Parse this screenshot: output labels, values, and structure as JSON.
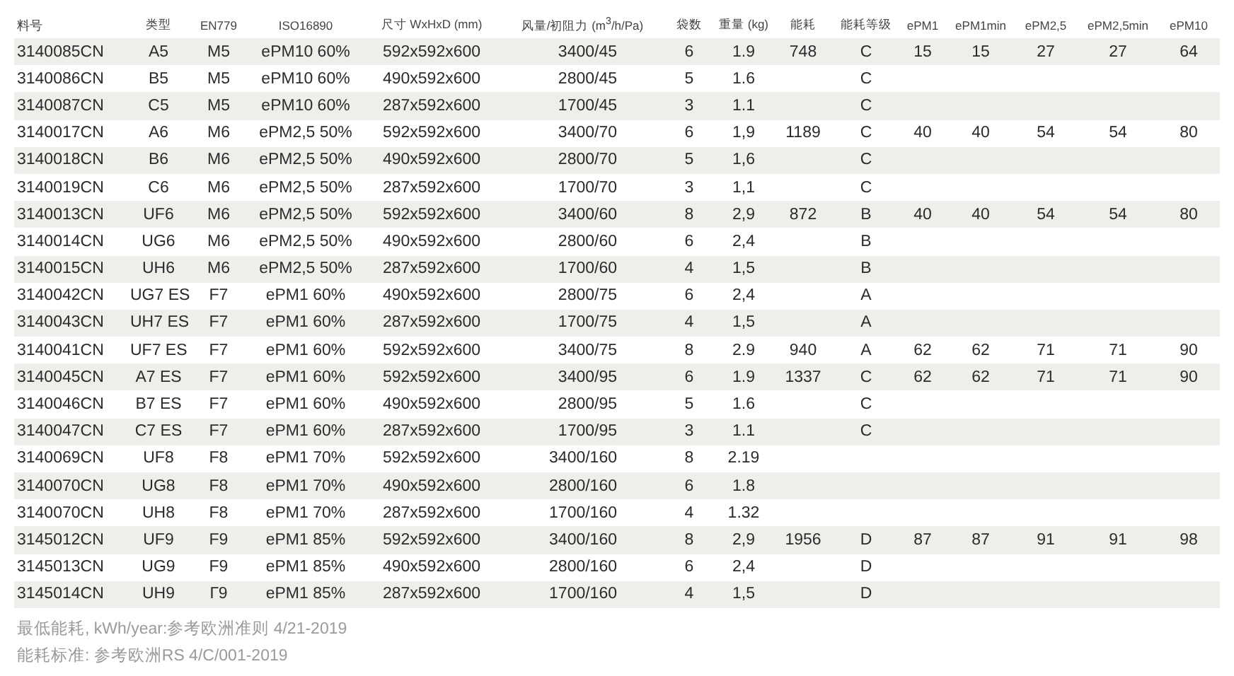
{
  "table": {
    "columns": [
      "料号",
      "类型",
      "EN779",
      "ISO16890",
      "尺寸 WxHxD (mm)",
      "风量/初阻力 (m$^{3}$/h/Pa)",
      "袋数",
      "重量 (kg)",
      "能耗",
      "能耗等级",
      "ePM1",
      "ePM1min",
      "ePM2,5",
      "ePM2,5min",
      "ePM10"
    ],
    "rows": [
      {
        "part_no": "3140085CN",
        "type": "A5",
        "en779": "M5",
        "iso16890": "ePM10 60%",
        "size": "592x592x600",
        "airflow": "3400/45",
        "bags": "6",
        "weight": "1.9",
        "energy": "748",
        "energy_class": "C",
        "epm1": "15",
        "epm1_min": "15",
        "epm2_5": "27",
        "epm2_5_min": "27",
        "epm10": "64"
      },
      {
        "part_no": "3140086CN",
        "type": "B5",
        "en779": "M5",
        "iso16890": "ePM10 60%",
        "size": "490x592x600",
        "airflow": "2800/45",
        "bags": "5",
        "weight": "1.6",
        "energy_class": "C"
      },
      {
        "part_no": "3140087CN",
        "type": "C5",
        "en779": "M5",
        "iso16890": "ePM10 60%",
        "size": "287x592x600",
        "airflow": "1700/45",
        "bags": "3",
        "weight": "1.1",
        "energy_class": "C"
      },
      {
        "part_no": "3140017CN",
        "type": "A6",
        "en779": "M6",
        "iso16890": "ePM2,5 50%",
        "size": "592x592x600",
        "airflow": "3400/70",
        "bags": "6",
        "weight": "1,9",
        "energy": "1189",
        "energy_class": "C",
        "epm1": "40",
        "epm1_min": "40",
        "epm2_5": "54",
        "epm2_5_min": "54",
        "epm10": "80"
      },
      {
        "part_no": "3140018CN",
        "type": "B6",
        "en779": "M6",
        "iso16890": "ePM2,5 50%",
        "size": "490x592x600",
        "airflow": "2800/70",
        "bags": "5",
        "weight": "1,6",
        "energy_class": "C"
      },
      {
        "part_no": "3140019CN",
        "type": "C6",
        "en779": "M6",
        "iso16890": "ePM2,5 50%",
        "size": "287x592x600",
        "airflow": "1700/70",
        "bags": "3",
        "weight": "1,1",
        "energy_class": "C"
      },
      {
        "part_no": "3140013CN",
        "type": "UF6",
        "en779": "M6",
        "iso16890": "ePM2,5 50%",
        "size": "592x592x600",
        "airflow": "3400/60",
        "bags": "8",
        "weight": "2,9",
        "energy": "872",
        "energy_class": "B",
        "epm1": "40",
        "epm1_min": "40",
        "epm2_5": "54",
        "epm2_5_min": "54",
        "epm10": "80"
      },
      {
        "part_no": "3140014CN",
        "type": "UG6",
        "en779": "M6",
        "iso16890": "ePM2,5 50%",
        "size": "490x592x600",
        "airflow": "2800/60",
        "bags": "6",
        "weight": "2,4",
        "energy_class": "B"
      },
      {
        "part_no": "3140015CN",
        "type": "UH6",
        "en779": "M6",
        "iso16890": "ePM2,5 50%",
        "size": "287x592x600",
        "airflow": "1700/60",
        "bags": "4",
        "weight": "1,5",
        "energy_class": "B"
      },
      {
        "part_no": "3140042CN",
        "type": "UG7 ES",
        "en779": "F7",
        "iso16890": "ePM1 60%",
        "size": "490x592x600",
        "airflow": "2800/75",
        "bags": "6",
        "weight": "2,4",
        "energy_class": "A"
      },
      {
        "part_no": "3140043CN",
        "type": "UH7 ES",
        "en779": "F7",
        "iso16890": "ePM1 60%",
        "size": "287x592x600",
        "airflow": "1700/75",
        "bags": "4",
        "weight": "1,5",
        "energy_class": "A"
      },
      {
        "part_no": "3140041CN",
        "type": "UF7 ES",
        "en779": "F7",
        "iso16890": "ePM1 60%",
        "size": "592x592x600",
        "airflow": "3400/75",
        "bags": "8",
        "weight": "2.9",
        "energy": "940",
        "energy_class": "A",
        "epm1": "62",
        "epm1_min": "62",
        "epm2_5": "71",
        "epm2_5_min": "71",
        "epm10": "90"
      },
      {
        "part_no": "3140045CN",
        "type": "A7 ES",
        "en779": "F7",
        "iso16890": "ePM1 60%",
        "size": "592x592x600",
        "airflow": "3400/95",
        "bags": "6",
        "weight": "1.9",
        "energy": "1337",
        "energy_class": "C",
        "epm1": "62",
        "epm1_min": "62",
        "epm2_5": "71",
        "epm2_5_min": "71",
        "epm10": "90"
      },
      {
        "part_no": "3140046CN",
        "type": "B7 ES",
        "en779": "F7",
        "iso16890": "ePM1 60%",
        "size": "490x592x600",
        "airflow": "2800/95",
        "bags": "5",
        "weight": "1.6",
        "energy_class": "C"
      },
      {
        "part_no": "3140047CN",
        "type": "C7 ES",
        "en779": "F7",
        "iso16890": "ePM1 60%",
        "size": "287x592x600",
        "airflow": "1700/95",
        "bags": "3",
        "weight": "1.1",
        "energy_class": "C"
      },
      {
        "part_no": "3140069CN",
        "type": "UF8",
        "en779": "F8",
        "iso16890": "ePM1 70%",
        "size": "592x592x600",
        "airflow": "3400/160",
        "bags": "8",
        "weight": "2.19"
      },
      {
        "part_no": "3140070CN",
        "type": "UG8",
        "en779": "F8",
        "iso16890": "ePM1 70%",
        "size": "490x592x600",
        "airflow": "2800/160",
        "bags": "6",
        "weight": "1.8"
      },
      {
        "part_no": "3140070CN",
        "type": "UH8",
        "en779": "F8",
        "iso16890": "ePM1 70%",
        "size": "287x592x600",
        "airflow": "1700/160",
        "bags": "4",
        "weight": "1.32"
      },
      {
        "part_no": "3145012CN",
        "type": "UF9",
        "en779": "F9",
        "iso16890": "ePM1 85%",
        "size": "592x592x600",
        "airflow": "3400/160",
        "bags": "8",
        "weight": "2,9",
        "energy": "1956",
        "energy_class": "D",
        "epm1": "87",
        "epm1_min": "87",
        "epm2_5": "91",
        "epm2_5_min": "91",
        "epm10": "98"
      },
      {
        "part_no": "3145013CN",
        "type": "UG9",
        "en779": "F9",
        "iso16890": "ePM1 85%",
        "size": "490x592x600",
        "airflow": "2800/160",
        "bags": "6",
        "weight": "2,4",
        "energy_class": "D"
      },
      {
        "part_no": "3145014CN",
        "type": "UH9",
        "en779": "Г9",
        "iso16890": "ePM1 85%",
        "size": "287x592x600",
        "airflow": "1700/160",
        "bags": "4",
        "weight": "1,5",
        "energy_class": "D"
      }
    ]
  },
  "footnotes": [
    "最低能耗, kWh/year:参考欧洲准则 4/21-2019",
    "能耗标准: 参考欧洲RS 4/C/001-2019"
  ]
}
